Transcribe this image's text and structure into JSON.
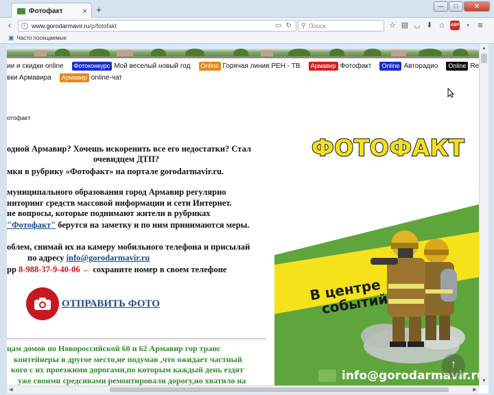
{
  "browser": {
    "tab_title": "Фотофакт",
    "tab_close": "×",
    "new_tab": "+",
    "window_controls": {
      "minimize": "—",
      "maximize": "□",
      "close": "✕"
    },
    "url_host": "www.gorodarmavir.ru",
    "url_path": "/p/fotofakt",
    "search_placeholder": "Поиск",
    "bookmarks_label": "Часто посещаемые",
    "icons": [
      "back-icon",
      "info-icon",
      "reader-icon",
      "reload-icon",
      "search-icon",
      "star-icon",
      "clipboard-icon",
      "pocket-icon",
      "download-icon",
      "home-icon",
      "adblock-icon",
      "menu-icon"
    ],
    "adblock_badge": "ABP"
  },
  "site": {
    "menu_row1": [
      {
        "badge": "",
        "label": "ии и скидки online",
        "badge_color": ""
      },
      {
        "badge": "Фотоконкурс",
        "label": "Мой веселый новый год",
        "badge_color": "#1a2fc9"
      },
      {
        "badge": "Online",
        "label": "Горячая линия РЕН - ТВ",
        "badge_color": "#e58a16"
      },
      {
        "badge": "Армавир",
        "label": "Фотофакт",
        "badge_color": "#d41f1f"
      },
      {
        "badge": "Online",
        "label": "Авторадио",
        "badge_color": "#1a2fc9"
      },
      {
        "badge": "Online",
        "label": "Record",
        "badge_color": "#111111"
      }
    ],
    "menu_row2": [
      {
        "badge": "",
        "label": "вки Армавира",
        "badge_color": ""
      },
      {
        "badge": "Армавир",
        "label": "online-чат",
        "badge_color": "#e58a16"
      }
    ],
    "breadcrumb": "отофакт",
    "intro": {
      "line1": "одной Армавир? Хочешь искоренить все его недостатки? Стал",
      "line2": "очевидцем ДТП?",
      "line3": "мки в рубрику «Фотофакт» на портале gorodarmavir.ru.",
      "line4": "муниципального образования город Армавир регулярно",
      "line5": "ниторинг средств массовой информации и сети Интернет.",
      "line6": "ие вопросы, которые поднимают жители в рубриках",
      "line7_link": "\"Фотофакт\"",
      "line7_rest": " берутся на заметку и по ним принимаются меры.",
      "line8": "облем, снимай их на камеру мобильного телефона и присылай",
      "line9_prefix": "по адресу ",
      "line9_email": "info@gorodarmavir.ru",
      "line10_prefix": "рр ",
      "line10_phone": "8-988-37-9-40-06 ←",
      "line10_rest": " сохраните номер в своем телефоне"
    },
    "send_photo_label": "ОТПРАВИТЬ ФОТО",
    "news": {
      "line1": "цам домов по Новороссийской 60 и 62 Армавир гор транс",
      "line2": "контейнеры  в другое место,не подумав ,что ожидает частный",
      "line3": "кого с их проезжими дорогами,по которым каждый день ездят",
      "line4": "уже своими средсивами ремонтировали дорогу,но хватило на"
    },
    "promo": {
      "title": "ФОТОФАКТ",
      "slogan_line1": "В центре",
      "slogan_line2": "событий",
      "email": "info@gorodarmavir.ru",
      "accent_yellow": "#f5e21b",
      "accent_green": "#5ea63c"
    },
    "scroll_top_icon": "↑"
  },
  "scrollbars": {
    "up": "▲",
    "down": "▼",
    "left": "◀",
    "right": "▶"
  }
}
